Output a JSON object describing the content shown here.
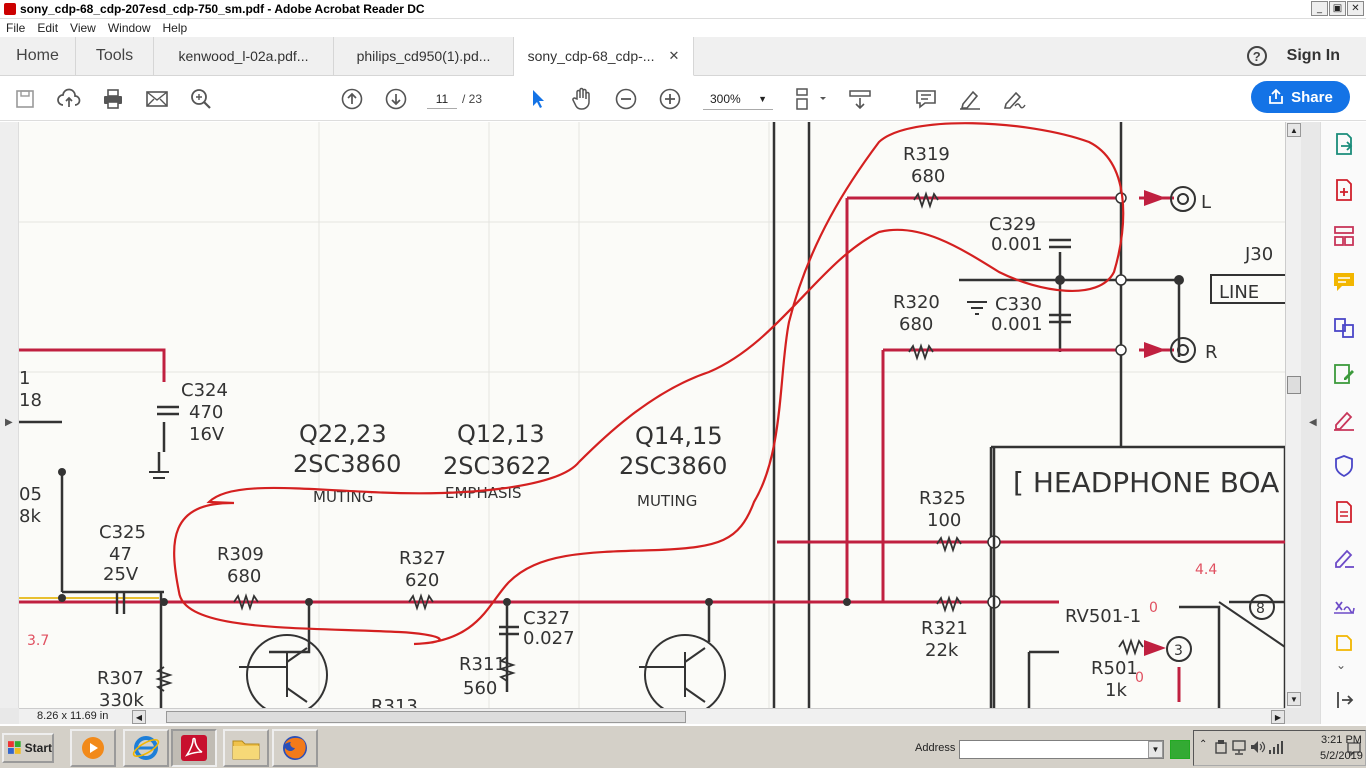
{
  "window": {
    "title": "sony_cdp-68_cdp-207esd_cdp-750_sm.pdf - Adobe Acrobat Reader DC",
    "controls": [
      "_",
      "▣",
      "✕"
    ]
  },
  "menu": [
    "File",
    "Edit",
    "View",
    "Window",
    "Help"
  ],
  "tabs": {
    "home": "Home",
    "tools": "Tools",
    "docs": [
      "kenwood_l-02a.pdf...",
      "philips_cd950(1).pd...",
      "sony_cdp-68_cdp-..."
    ],
    "close": "✕",
    "help": "?",
    "signin": "Sign In"
  },
  "toolbar": {
    "page_current": "11",
    "page_total": "/ 23",
    "zoom": "300%",
    "share": "Share"
  },
  "status": {
    "dimensions": "8.26 x 11.69 in"
  },
  "schematic": {
    "labels": {
      "r319": "R319",
      "r319v": "680",
      "c329": "C329",
      "c329v": "0.001",
      "r320": "R320",
      "r320v": "680",
      "c330": "C330",
      "c330v": "0.001",
      "out_l": "L",
      "out_r": "R",
      "j30": "J30",
      "line": "LINE",
      "c324": "C324",
      "c324v": "470",
      "c324v2": "16V",
      "q2223": "Q22,23",
      "q2223p": "2SC3860",
      "muting1": "MUTING",
      "q1213": "Q12,13",
      "q1213p": "2SC3622",
      "emphasis": "EMPHASIS",
      "q1415": "Q14,15",
      "q1415p": "2SC3860",
      "muting2": "MUTING",
      "c325": "C325",
      "c325v": "47",
      "c325v2": "25V",
      "r309": "R309",
      "r309v": "680",
      "r327": "R327",
      "r327v": "620",
      "c327": "C327",
      "c327v": "0.027",
      "r311": "R311",
      "r311v": "560",
      "r307": "R307",
      "r307v": "330k",
      "r313": "R313",
      "r325": "R325",
      "r325v": "100",
      "r321": "R321",
      "r321v": "22k",
      "headphone": "[ HEADPHONE BOA",
      "rv501": "RV501-1",
      "r501": "R501",
      "r501v": "1k",
      "pin8": "8",
      "pin3": "3",
      "v44": "4.4",
      "v0a": "0",
      "v0b": "0",
      "v37": "3.7",
      "left18": "18",
      "left05": "05",
      "left8k": "8k",
      "left1": "1"
    }
  },
  "taskbar": {
    "start": "Start",
    "address": "Address",
    "time": "3:21 PM",
    "date": "5/2/2019"
  },
  "colors": {
    "accent": "#1473e6",
    "pdf_red": "#c8102e",
    "circle_red": "#d42020",
    "wire_red": "#c02040"
  }
}
